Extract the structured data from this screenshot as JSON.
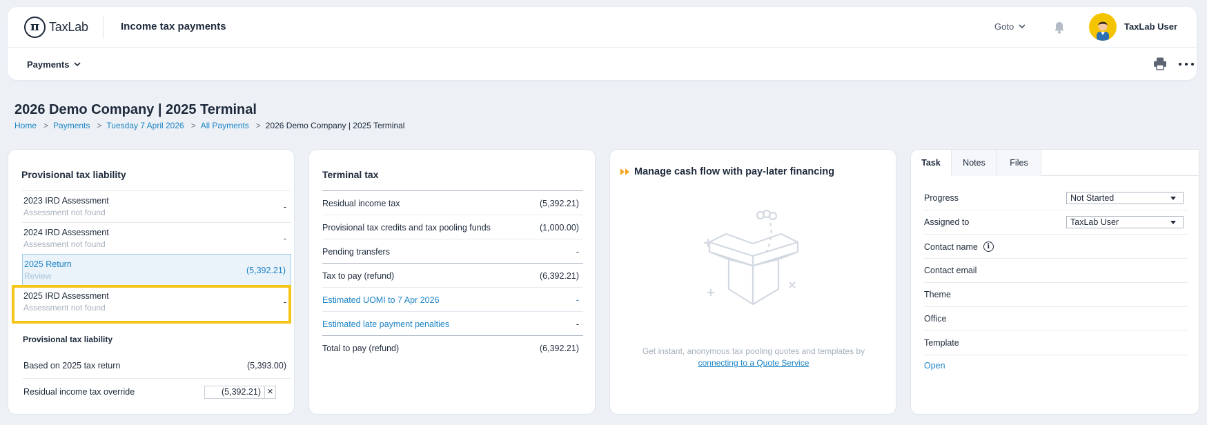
{
  "app": {
    "logo_text": "TaxLab",
    "logo_glyph": "π",
    "title": "Income tax payments",
    "goto_label": "Goto",
    "user_name": "TaxLab User"
  },
  "subnav": {
    "payments_label": "Payments"
  },
  "page": {
    "title": "2026 Demo Company | 2025 Terminal",
    "breadcrumb": [
      "Home",
      "Payments",
      "Tuesday 7 April 2026",
      "All Payments",
      "2026 Demo Company | 2025 Terminal"
    ],
    "breadcrumb_sep": ">"
  },
  "provisional": {
    "title": "Provisional tax liability",
    "items": [
      {
        "title": "2023 IRD Assessment",
        "subtitle": "Assessment not found",
        "value": "-"
      },
      {
        "title": "2024 IRD Assessment",
        "subtitle": "Assessment not found",
        "value": "-"
      },
      {
        "title": "2025 Return",
        "subtitle": "Review",
        "value": "(5,392.21)"
      },
      {
        "title": "2025 IRD Assessment",
        "subtitle": "Assessment not found",
        "value": "-"
      }
    ],
    "sub_title": "Provisional tax liability",
    "based_on_label": "Based on 2025 tax return",
    "based_on_value": "(5,393.00)",
    "override_label": "Residual income tax override",
    "override_value": "(5,392.21)",
    "clear_glyph": "✕"
  },
  "terminal": {
    "title": "Terminal tax",
    "rows": [
      {
        "label": "Residual income tax",
        "value": "(5,392.21)"
      },
      {
        "label": "Provisional tax credits and tax pooling funds",
        "value": "(1,000.00)"
      },
      {
        "label": "Pending transfers",
        "value": "-"
      },
      {
        "label": "Tax to pay (refund)",
        "value": "(6,392.21)"
      },
      {
        "label": "Estimated UOMI to 7 Apr 2026",
        "value": "-"
      },
      {
        "label": "Estimated late payment penalties",
        "value": "-"
      },
      {
        "label": "Total to pay (refund)",
        "value": "(6,392.21)"
      }
    ]
  },
  "cashflow": {
    "title": "Manage cash flow with pay-later financing",
    "text": "Get instant, anonymous tax pooling quotes and templates by",
    "link": "connecting to a Quote Service"
  },
  "task_panel": {
    "tabs": [
      "Task",
      "Notes",
      "Files"
    ],
    "rows": [
      {
        "label": "Progress",
        "value": "Not Started"
      },
      {
        "label": "Assigned to",
        "value": "TaxLab User"
      },
      {
        "label": "Contact name"
      },
      {
        "label": "Contact email"
      },
      {
        "label": "Theme"
      },
      {
        "label": "Office"
      },
      {
        "label": "Template"
      }
    ],
    "open_label": "Open"
  },
  "colors": {
    "accent": "#1d84c5",
    "highlight": "#f5c518",
    "avatar_bg": "#f5c400",
    "page_bg": "#edf1f6"
  },
  "icons": [
    "bell-icon",
    "chevron-down-icon",
    "printer-icon",
    "more-icon",
    "info-icon",
    "double-arrow-icon",
    "open-box-icon"
  ]
}
